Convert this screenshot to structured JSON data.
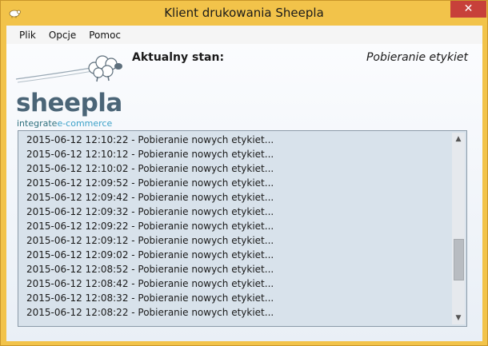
{
  "window": {
    "title": "Klient drukowania Sheepla",
    "close_glyph": "✕",
    "app_icon": "sheep-icon",
    "accent_color": "#f2c34a"
  },
  "menu": {
    "items": [
      "Plik",
      "Opcje",
      "Pomoc"
    ]
  },
  "logo": {
    "word": "sheepla",
    "tag_part1": "integrate",
    "tag_part2": "e-commerce",
    "icon": "sheep-cloud-logo"
  },
  "status": {
    "label": "Aktualny stan:",
    "value": "Pobieranie etykiet"
  },
  "log": {
    "lines": [
      "2015-06-12 12:10:22 - Pobieranie nowych etykiet...",
      "2015-06-12 12:10:12 - Pobieranie nowych etykiet...",
      "2015-06-12 12:10:02 - Pobieranie nowych etykiet...",
      "2015-06-12 12:09:52 - Pobieranie nowych etykiet...",
      "2015-06-12 12:09:42 - Pobieranie nowych etykiet...",
      "2015-06-12 12:09:32 - Pobieranie nowych etykiet...",
      "2015-06-12 12:09:22 - Pobieranie nowych etykiet...",
      "2015-06-12 12:09:12 - Pobieranie nowych etykiet...",
      "2015-06-12 12:09:02 - Pobieranie nowych etykiet...",
      "2015-06-12 12:08:52 - Pobieranie nowych etykiet...",
      "2015-06-12 12:08:42 - Pobieranie nowych etykiet...",
      "2015-06-12 12:08:32 - Pobieranie nowych etykiet...",
      "2015-06-12 12:08:22 - Pobieranie nowych etykiet..."
    ]
  },
  "scrollbar": {
    "up_glyph": "▲",
    "down_glyph": "▼"
  }
}
